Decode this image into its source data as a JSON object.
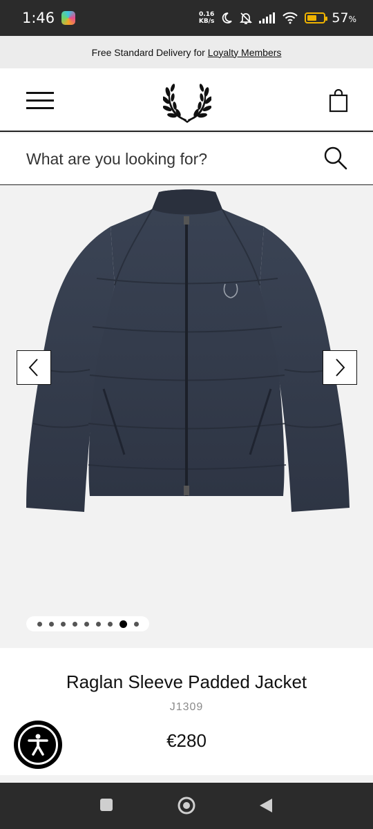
{
  "status_bar": {
    "time": "1:46",
    "net_speed_value": "0.16",
    "net_speed_unit": "KB/s",
    "battery_percent": "57",
    "battery_unit": "%",
    "battery_level": 0.57
  },
  "promo": {
    "prefix": "Free Standard Delivery for",
    "link": "Loyalty Members"
  },
  "header": {
    "menu_icon": "hamburger-menu-icon",
    "logo_icon": "laurel-wreath-logo",
    "bag_icon": "shopping-bag-icon"
  },
  "search": {
    "placeholder": "What are you looking for?",
    "icon": "search-icon"
  },
  "gallery": {
    "dot_count": 9,
    "active_index": 7,
    "prev_icon": "chevron-left-icon",
    "next_icon": "chevron-right-icon"
  },
  "product": {
    "name": "Raglan Sleeve Padded Jacket",
    "code": "J1309",
    "price": "€280"
  },
  "accessibility": {
    "icon": "accessibility-icon"
  },
  "nav": {
    "recents_icon": "square-recents-icon",
    "home_icon": "circle-home-icon",
    "back_icon": "triangle-back-icon"
  },
  "colors": {
    "jacket": "#353d4d",
    "status_bar": "#2b2b2b",
    "battery": "#f0b400"
  }
}
